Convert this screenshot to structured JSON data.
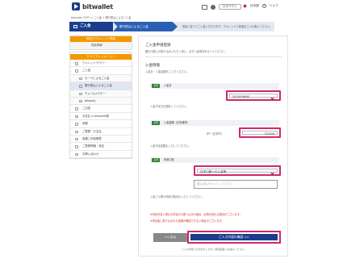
{
  "header": {
    "logo_text": "bitwallet",
    "logout_label": "ログアウト",
    "language_label": "日本語",
    "help_label": "ヘルプ"
  },
  "breadcrumb": "bitwallet (TOP) > ご入金 > 銀行振込によるご入金",
  "stepbar": {
    "title": "ご入金",
    "current_step": "銀行振込によるご入金",
    "hint": "既定に従ってご入金いただけます。ウォレットに資金をご入れ換えください。"
  },
  "sidebar": {
    "wallet_head": "現在のウォレット残高",
    "wallet_sub": "残高情報",
    "menu_head": "クライアントメニュー",
    "items": [
      {
        "label": "ウォレットサマリー",
        "sub": false,
        "active": false
      },
      {
        "label": "ご入金",
        "sub": false,
        "active": false
      },
      {
        "label": "カードによるご入金",
        "sub": true,
        "active": false
      },
      {
        "label": "銀行振込によるご入金",
        "sub": true,
        "active": true
      },
      {
        "label": "ちょコムeマネー",
        "sub": true,
        "active": false
      },
      {
        "label": "bitwpay",
        "sub": true,
        "active": false
      },
      {
        "label": "ご出金",
        "sub": false,
        "active": false
      },
      {
        "label": "お支払 & bitwallet間",
        "sub": false,
        "active": false
      },
      {
        "label": "両替",
        "sub": false,
        "active": false
      },
      {
        "label": "ご履歴・お支払",
        "sub": false,
        "active": false
      },
      {
        "label": "各種ご利用履歴",
        "sub": false,
        "active": false
      },
      {
        "label": "ご登録情報・設定",
        "sub": false,
        "active": false
      },
      {
        "label": "お問い合わせ",
        "sub": false,
        "active": false
      }
    ]
  },
  "form": {
    "title": "ご入金申請登録",
    "description": "銀行口座にお振り込みいただく前に、必ず入金申請を行ってください。",
    "section_title": "入金情報",
    "section_desc": "入金日・入金金額をご入力ください。",
    "required_badge": "必須",
    "date_label": "入金日",
    "date_value": "2025/06/08",
    "date_note": "入金予定日を選択してください。",
    "amount_label": "入金金額（日本通貨）",
    "amount_prefix": "JPY（日本円）",
    "amount_value": "70,000",
    "amount_note": "入金予定金額を入力してください。",
    "method_label": "利用口座",
    "method_value": "日本口座への入金等",
    "comment_placeholder": "振込名義人を入力してください",
    "method_note": "入金した際の利用口座名を入力してください。",
    "warning_1": "※申請内容と異なる内容のお振り込みの場合、反映が遅れる場合がございます。",
    "warning_2": "※申請後に振り込まれた金額が確認できない場合がございます。",
    "back_label": "<< 戻る",
    "confirm_label": "ご入力内容の確認 >>",
    "footnote": "ご入力内容でお手続きします。確認画面へお進みください。"
  },
  "colors": {
    "brand_navy": "#1a3e8c",
    "accent_orange": "#f39800",
    "highlight_pink": "#d1276a",
    "required_green": "#2e7d32"
  }
}
